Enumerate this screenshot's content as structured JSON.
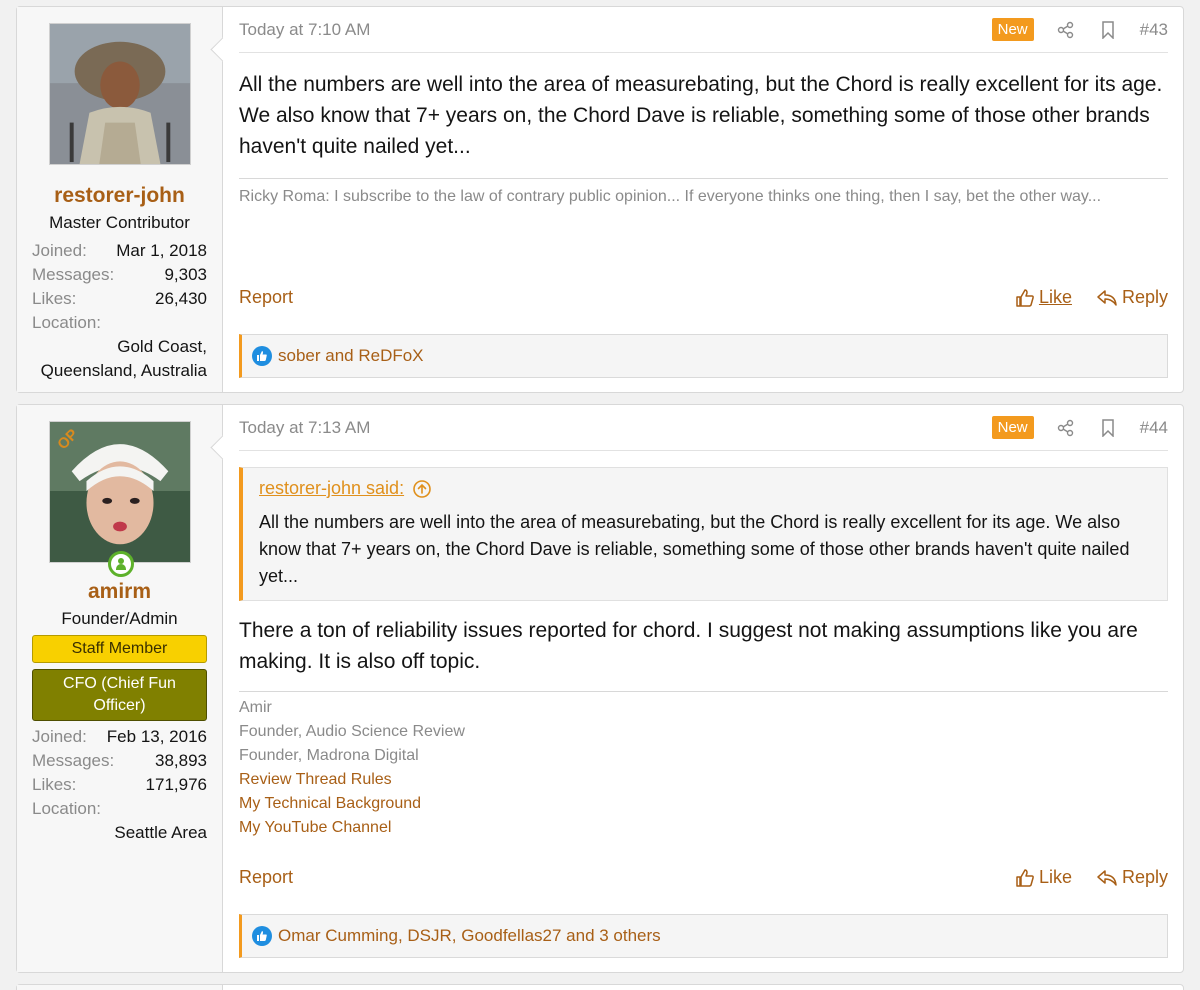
{
  "posts": [
    {
      "user": {
        "name": "restorer-john",
        "title": "Master Contributor",
        "stats": [
          {
            "k": "Joined:",
            "v": "Mar 1, 2018"
          },
          {
            "k": "Messages:",
            "v": "9,303"
          },
          {
            "k": "Likes:",
            "v": "26,430"
          }
        ],
        "location_label": "Location:",
        "location_value": "Gold Coast, Queensland, Australia"
      },
      "date": "Today at 7:10 AM",
      "badge": "New",
      "number": "#43",
      "body": "All the numbers are well into the area of measurebating, but the Chord is really excellent for its age. We also know that 7+ years on, the Chord Dave is reliable, something some of those other brands haven't quite nailed yet...",
      "signature": "Ricky Roma: I subscribe to the law of contrary public opinion... If everyone thinks one thing, then I say, bet the other way...",
      "report": "Report",
      "like": "Like",
      "reply": "Reply",
      "reactions": "sober and ReDFoX"
    },
    {
      "user": {
        "name": "amirm",
        "op": "OP",
        "title": "Founder/Admin",
        "banner_staff": "Staff Member",
        "banner_cfo": "CFO (Chief Fun Officer)",
        "stats": [
          {
            "k": "Joined:",
            "v": "Feb 13, 2016"
          },
          {
            "k": "Messages:",
            "v": "38,893"
          },
          {
            "k": "Likes:",
            "v": "171,976"
          }
        ],
        "location_label": "Location:",
        "location_value": "Seattle Area"
      },
      "date": "Today at 7:13 AM",
      "badge": "New",
      "number": "#44",
      "quote_author": "restorer-john said:",
      "quote_body": "All the numbers are well into the area of measurebating, but the Chord is really excellent for its age. We also know that 7+ years on, the Chord Dave is reliable, something some of those other brands haven't quite nailed yet...",
      "body": "There a ton of reliability issues reported for chord. I suggest not making assumptions like you are making. It is also off topic.",
      "signature_lines": [
        "Amir",
        "Founder, Audio Science Review",
        "Founder, Madrona Digital"
      ],
      "signature_links": [
        "Review Thread Rules",
        "My Technical Background",
        "My YouTube Channel"
      ],
      "report": "Report",
      "like": "Like",
      "reply": "Reply",
      "reactions": "Omar Cumming, DSJR, Goodfellas27 and 3 others"
    }
  ],
  "colors": {
    "link": "#a85f16",
    "accent": "#f39a1e",
    "staff_banner": "#f8d000",
    "cfo_banner": "#808000",
    "online": "#5db12b"
  }
}
